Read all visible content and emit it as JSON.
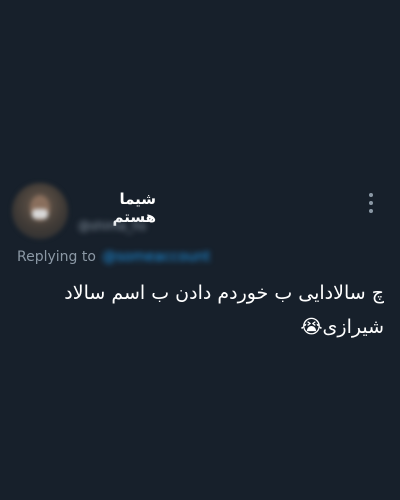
{
  "app": {
    "background_color": "#17202b",
    "accent_color": "#1d9bf0",
    "secondary_text_color": "#8b98a5"
  },
  "tweet": {
    "author": {
      "display_name": "شیما هستم",
      "handle": "@shima_hs"
    },
    "reply": {
      "prefix": "Replying to",
      "target": "@someaccount"
    },
    "text": "چ سالادایی ب خوردم دادن ب اسم سالاد شیرازی😭",
    "more_icon": "more-vertical-icon"
  }
}
